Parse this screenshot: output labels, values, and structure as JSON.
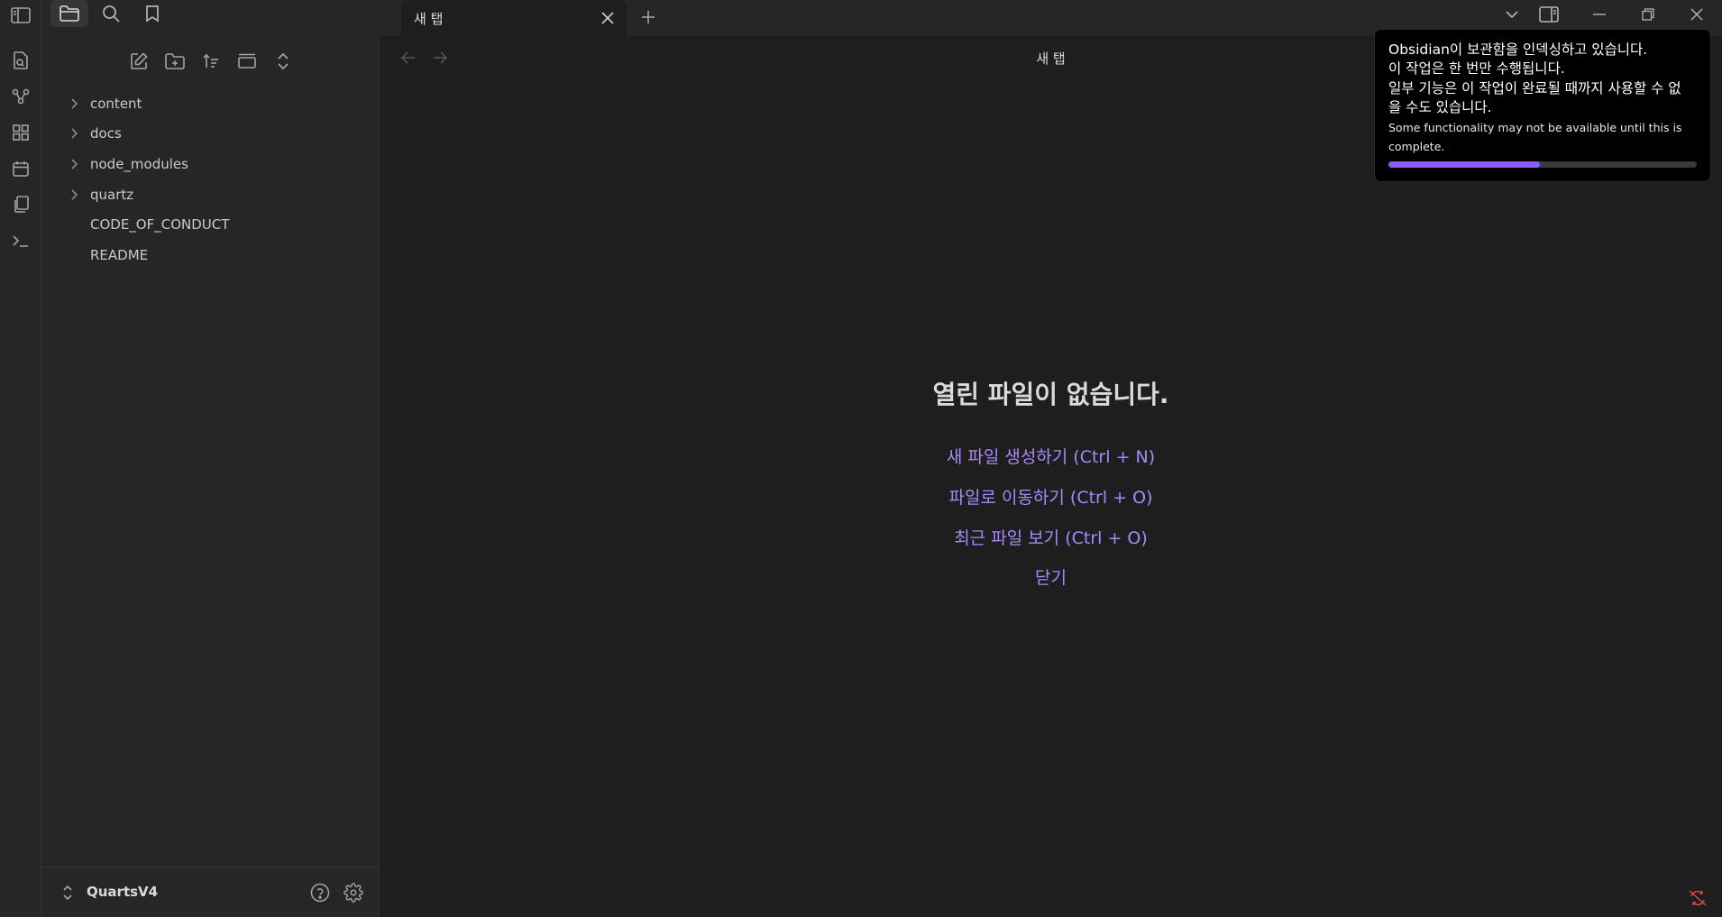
{
  "tabs": {
    "active_title": "새 탭"
  },
  "file_tree": {
    "folders": [
      "content",
      "docs",
      "node_modules",
      "quartz"
    ],
    "files": [
      "CODE_OF_CONDUCT",
      "README"
    ]
  },
  "vault": {
    "name": "QuartsV4"
  },
  "main": {
    "view_title": "새 탭",
    "empty_title": "열린 파일이 없습니다.",
    "actions": [
      "새 파일 생성하기 (Ctrl + N)",
      "파일로 이동하기 (Ctrl + O)",
      "최근 파일 보기 (Ctrl + O)",
      "닫기"
    ]
  },
  "notice": {
    "lines": [
      "Obsidian이 보관함을 인덱싱하고 있습니다.",
      "이 작업은 한 번만 수행됩니다.",
      "일부 기능은 이 작업이 완료될 때까지 사용할 수 없",
      "을 수도 있습니다."
    ],
    "subtext": "Some functionality may not be available until this is complete.",
    "progress": 0.49
  },
  "colors": {
    "accent": "#a68af9",
    "progress": "#8a5cf5"
  },
  "icons": [
    "sidebar-toggle-icon",
    "folder-icon",
    "search-icon",
    "bookmark-icon",
    "new-note-icon",
    "new-folder-icon",
    "sort-icon",
    "collapse-icon",
    "expand-all-icon",
    "open-file-icon",
    "graph-icon",
    "canvas-icon",
    "calendar-icon",
    "templates-icon",
    "terminal-icon",
    "close-icon",
    "plus-icon",
    "chevron-down-icon",
    "right-sidebar-icon",
    "minimize-icon",
    "restore-icon",
    "back-arrow-icon",
    "forward-arrow-icon",
    "help-icon",
    "gear-icon",
    "sync-off-icon"
  ]
}
